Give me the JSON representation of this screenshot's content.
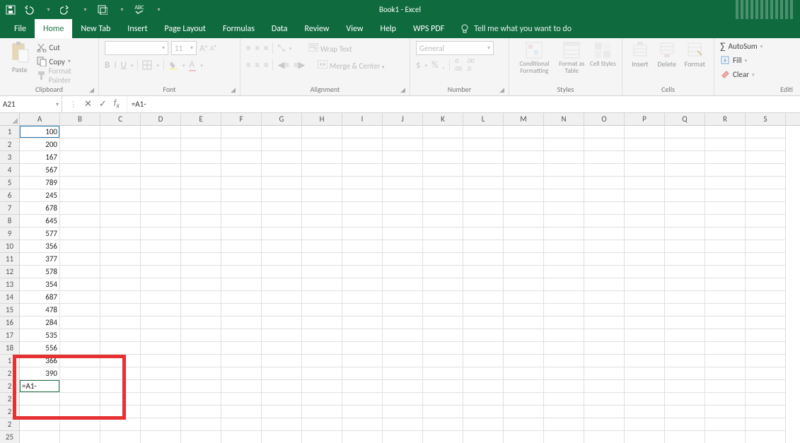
{
  "app": {
    "title": "Book1 - Excel"
  },
  "tabs": [
    "File",
    "Home",
    "New Tab",
    "Insert",
    "Page Layout",
    "Formulas",
    "Data",
    "Review",
    "View",
    "Help",
    "WPS PDF"
  ],
  "active_tab": "Home",
  "tellme": "Tell me what you want to do",
  "ribbon": {
    "clipboard": {
      "paste": "Paste",
      "cut": "Cut",
      "copy": "Copy",
      "fp": "Format Painter",
      "label": "Clipboard"
    },
    "font": {
      "name": "",
      "size": "11",
      "label": "Font"
    },
    "alignment": {
      "wrap": "Wrap Text",
      "merge": "Merge & Center",
      "label": "Alignment"
    },
    "number": {
      "format": "General",
      "label": "Number"
    },
    "styles": {
      "cf": "Conditional Formatting",
      "fat": "Format as Table",
      "cs": "Cell Styles",
      "label": "Styles"
    },
    "cells": {
      "ins": "Insert",
      "del": "Delete",
      "fmt": "Format",
      "label": "Cells"
    },
    "editing": {
      "as": "AutoSum",
      "fill": "Fill",
      "clr": "Clear",
      "label": "Editi"
    }
  },
  "namebox": "A21",
  "formula": "=A1-",
  "columns": [
    "A",
    "B",
    "C",
    "D",
    "E",
    "F",
    "G",
    "H",
    "I",
    "J",
    "K",
    "L",
    "M",
    "N",
    "O",
    "P",
    "Q",
    "R",
    "S"
  ],
  "rows": [
    "1",
    "2",
    "3",
    "4",
    "5",
    "6",
    "7",
    "8",
    "9",
    "10",
    "11",
    "12",
    "13",
    "14",
    "15",
    "16",
    "17",
    "18",
    "1",
    "2",
    "2",
    "2",
    "2",
    "2",
    "25"
  ],
  "cellsA": [
    "100",
    "200",
    "167",
    "567",
    "789",
    "245",
    "678",
    "645",
    "577",
    "356",
    "377",
    "578",
    "354",
    "687",
    "478",
    "284",
    "535",
    "556",
    "",
    "390",
    "=A1-",
    "",
    "",
    "",
    ""
  ],
  "a19_partial": "366"
}
